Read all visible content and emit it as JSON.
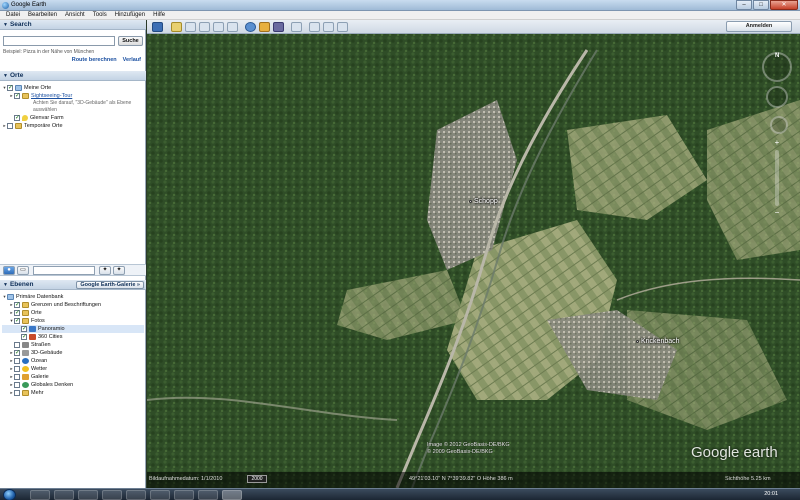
{
  "window": {
    "title": "Google Earth",
    "minimize": "–",
    "maximize": "□",
    "close": "✕"
  },
  "menu": [
    "Datei",
    "Bearbeiten",
    "Ansicht",
    "Tools",
    "Hinzufügen",
    "Hilfe"
  ],
  "search": {
    "header": "Search",
    "input_value": "",
    "button_label": "Suche",
    "hint": "Beispiel: Pizza in der Nähe von München",
    "link_route": "Route berechnen",
    "link_history": "Verlauf"
  },
  "places": {
    "header": "Orte",
    "items": [
      {
        "label": "Meine Orte"
      },
      {
        "label": "Sightseeing-Tour"
      },
      {
        "note": "Achten Sie darauf, \"3D-Gebäude\" als Ebene auswählen"
      },
      {
        "label": "Glenvar Farm"
      },
      {
        "label": "Temporäre Orte"
      }
    ]
  },
  "layers": {
    "header": "Ebenen",
    "gallery_button": "Google Earth-Galerie »",
    "items": [
      {
        "label": "Primäre Datenbank"
      },
      {
        "label": "Grenzen und Beschriftungen"
      },
      {
        "label": "Orte"
      },
      {
        "label": "Fotos"
      },
      {
        "label": "Panoramio"
      },
      {
        "label": "360 Cities"
      },
      {
        "label": "Straßen"
      },
      {
        "label": "3D-Gebäude"
      },
      {
        "label": "Ozean"
      },
      {
        "label": "Wetter"
      },
      {
        "label": "Galerie"
      },
      {
        "label": "Globales Denken"
      },
      {
        "label": "Mehr"
      }
    ]
  },
  "map": {
    "login_button": "Anmelden",
    "compass_n": "N",
    "zoom_plus": "+",
    "zoom_minus": "−",
    "labels": [
      {
        "name": "Schopp"
      },
      {
        "name": "Krickenbach"
      }
    ],
    "copyright_line1": "Image © 2012 GeoBasis-DE/BKG",
    "copyright_line2": "© 2009 GeoBasis-DE/BKG",
    "logo": "Google earth",
    "status_date": "Bildaufnahmedatum: 1/1/2010",
    "status_year": "2000",
    "status_coords": "49°21'03.10\" N   7°39'39.82\" O  Höhe  386 m",
    "status_alt": "Sichthöhe    5.25 km"
  },
  "taskbar": {
    "clock": "20:01"
  }
}
